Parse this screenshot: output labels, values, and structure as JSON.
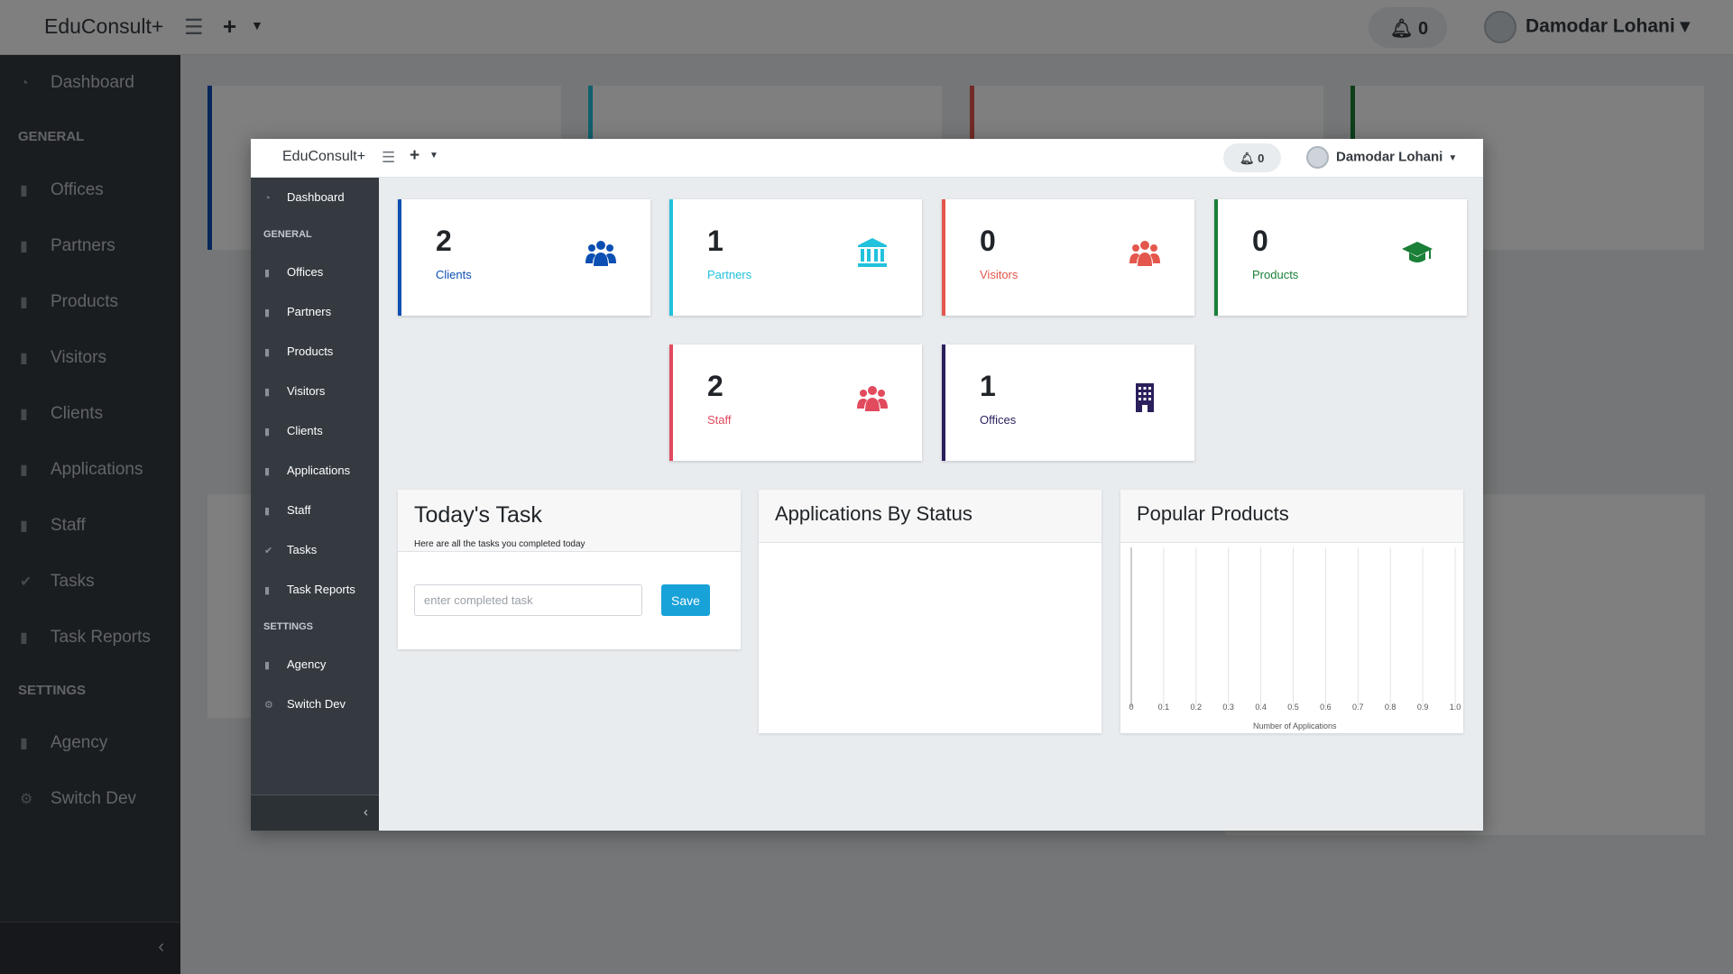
{
  "app": {
    "brand": "EduConsult+",
    "notifications": "0",
    "user_name": "Damodar Lohani"
  },
  "sidebar": {
    "dashboard": "Dashboard",
    "general_heading": "GENERAL",
    "general": [
      "Offices",
      "Partners",
      "Products",
      "Visitors",
      "Clients",
      "Applications",
      "Staff",
      "Tasks",
      "Task Reports"
    ],
    "settings_heading": "SETTINGS",
    "settings": [
      "Agency",
      "Switch Dev"
    ]
  },
  "cards": [
    {
      "value": "2",
      "label": "Clients",
      "color": "#0b4fb3",
      "icon": "users-icon"
    },
    {
      "value": "1",
      "label": "Partners",
      "color": "#22c1dc",
      "icon": "bank-icon"
    },
    {
      "value": "0",
      "label": "Visitors",
      "color": "#e4574c",
      "icon": "users-icon"
    },
    {
      "value": "0",
      "label": "Products",
      "color": "#1a7f37",
      "icon": "graduation-cap-icon"
    },
    {
      "value": "2",
      "label": "Staff",
      "color": "#e24a5e",
      "icon": "users-icon"
    },
    {
      "value": "1",
      "label": "Offices",
      "color": "#2b1f5c",
      "icon": "building-icon"
    }
  ],
  "task": {
    "title": "Today's Task",
    "subtitle": "Here are all the tasks you completed today",
    "placeholder": "enter completed task",
    "save_label": "Save"
  },
  "applications_by_status": {
    "title": "Applications By Status"
  },
  "popular_products": {
    "title": "Popular Products"
  },
  "chart_data": {
    "type": "bar",
    "title": "Popular Products",
    "orientation": "horizontal",
    "categories": [],
    "values": [],
    "xlabel": "Number of Applications",
    "xlim": [
      0,
      1.0
    ],
    "xticks": [
      "0",
      "0.1",
      "0.2",
      "0.3",
      "0.4",
      "0.5",
      "0.6",
      "0.7",
      "0.8",
      "0.9",
      "1.0"
    ],
    "grid": true
  }
}
